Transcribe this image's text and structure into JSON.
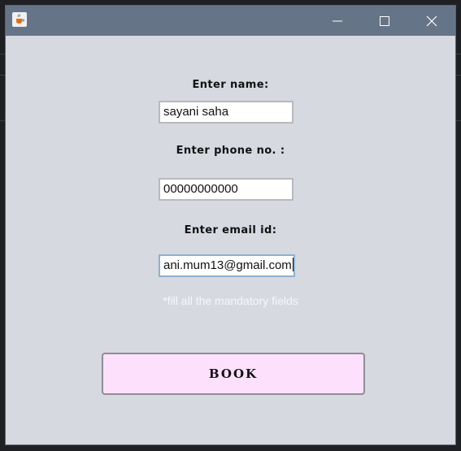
{
  "window": {
    "title": ""
  },
  "form": {
    "name_label": "Enter name:",
    "name_value": "sayani saha",
    "phone_label": "Enter phone no. :",
    "phone_value": "00000000000",
    "email_label": "Enter email id:",
    "email_value": "ani.mum13@gmail.com",
    "hint": "*fill all the mandatory fields",
    "book_label": "BOOK"
  },
  "icons": {
    "app": "java-cup-icon",
    "minimize": "minimize-icon",
    "maximize": "maximize-icon",
    "close": "close-icon"
  },
  "colors": {
    "titlebar": "#667488",
    "window_bg": "#d6d9e0",
    "button_bg": "#fde0fc",
    "hint_text": "#f7f7fb"
  }
}
